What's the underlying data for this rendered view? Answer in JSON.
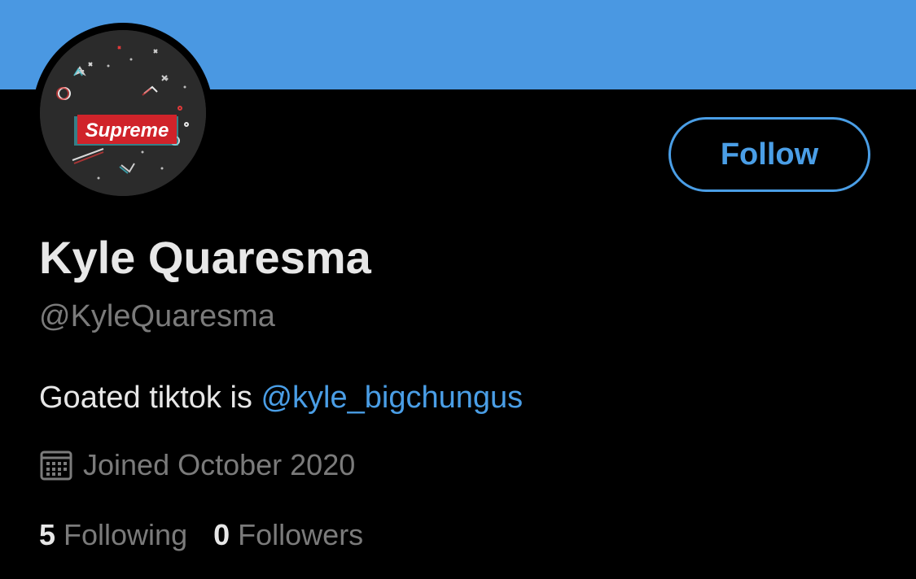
{
  "colors": {
    "banner": "#4a98e2",
    "background": "#000000",
    "accent": "#4a9ee6",
    "primary_text": "#e7e7e7",
    "secondary_text": "#7b7b7b",
    "logo_red": "#d0232a"
  },
  "avatar": {
    "logo_text": "Supreme"
  },
  "follow_button": {
    "label": "Follow"
  },
  "profile": {
    "name": "Kyle Quaresma",
    "handle": "@KyleQuaresma",
    "bio_text": "Goated tiktok is ",
    "bio_mention": "@kyle_bigchungus",
    "joined_icon": "calendar-icon",
    "joined": "Joined October 2020"
  },
  "stats": {
    "following_count": "5",
    "following_label": "Following",
    "followers_count": "0",
    "followers_label": "Followers"
  }
}
